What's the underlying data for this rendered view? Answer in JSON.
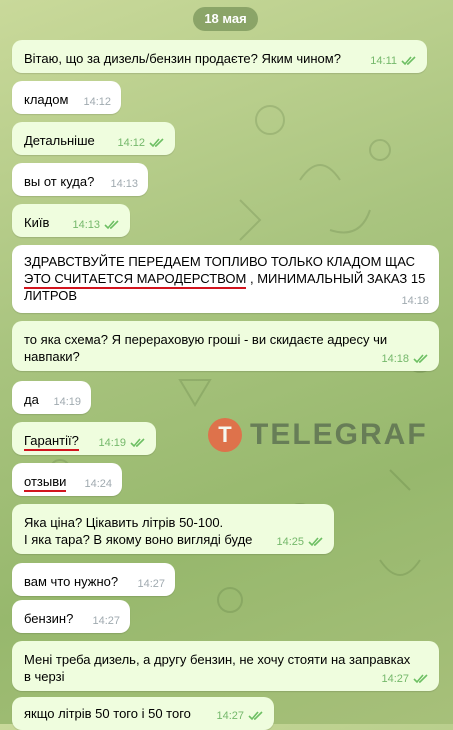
{
  "date_label": "18 мая",
  "watermark": {
    "logo_letter": "T",
    "text": "TELEGRAF"
  },
  "messages": [
    {
      "text": "Вітаю, що за дизель/бензин продаєте? Яким чином?",
      "time": "14:11",
      "outgoing": true
    },
    {
      "text": "кладом",
      "time": "14:12",
      "outgoing": false
    },
    {
      "text": "Детальніше",
      "time": "14:12",
      "outgoing": true
    },
    {
      "text": "вы от куда?",
      "time": "14:13",
      "outgoing": false
    },
    {
      "text": "Київ",
      "time": "14:13",
      "outgoing": true
    },
    {
      "line1": "ЗДРАВСТВУЙТЕ ПЕРЕДАЕМ ТОПЛИВО ТОЛЬКО КЛАДОМ ЩАС",
      "line2_underlined": "ЭТО СЧИТАЕТСЯ МАРОДЕРСТВОМ",
      "line2_rest": ", МИНИМАЛЬНЫЙ ЗАКАЗ 15",
      "line3": "ЛИТРОВ",
      "time": "14:18",
      "outgoing": false
    },
    {
      "text": "то яка схема? Я перераховую гроші - ви скидаєте адресу чи навпаки?",
      "time": "14:18",
      "outgoing": true
    },
    {
      "text": "да",
      "time": "14:19",
      "outgoing": false
    },
    {
      "text": "Гарантії?",
      "time": "14:19",
      "outgoing": true
    },
    {
      "text": "отзыви",
      "time": "14:24",
      "outgoing": false
    },
    {
      "line1": "Яка ціна? Цікавить літрів 50-100.",
      "line2": "І яка тара? В якому воно вигляді буде",
      "time": "14:25",
      "outgoing": true
    },
    {
      "text": "вам что нужно?",
      "time": "14:27",
      "outgoing": false
    },
    {
      "text": "бензин?",
      "time": "14:27",
      "outgoing": false
    },
    {
      "text": "Мені треба дизель, а другу бензин, не хочу стояти на заправках в черзі",
      "time": "14:27",
      "outgoing": true
    },
    {
      "text": "якщо літрів 50 того і 50 того",
      "time": "14:27",
      "outgoing": true
    }
  ]
}
